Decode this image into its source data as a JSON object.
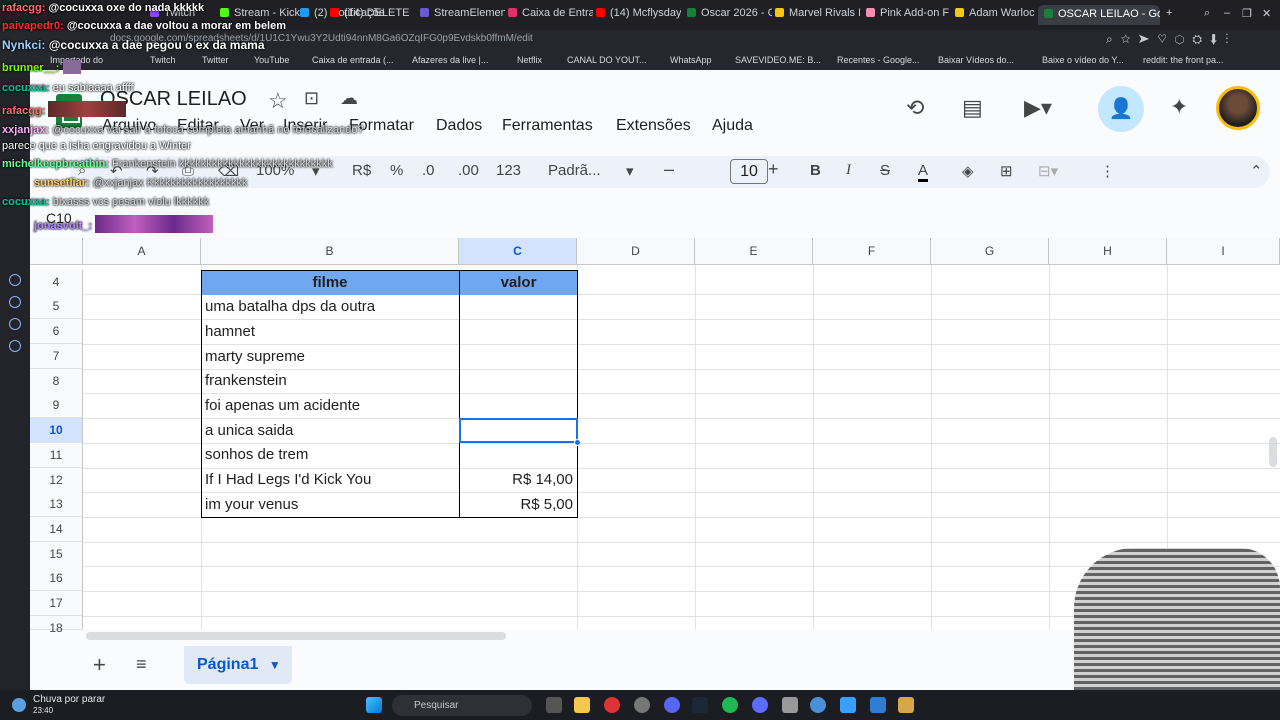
{
  "browser": {
    "tabs": [
      {
        "label": "Twitch",
        "color": "#9146ff"
      },
      {
        "label": "Stream - Kick",
        "color": "#53fc18"
      },
      {
        "label": "(2) Notificaçõe",
        "color": "#1d9bf0"
      },
      {
        "label": "(14) DELETE O",
        "color": "#ff0000"
      },
      {
        "label": "StreamElemen",
        "color": "#6a5acd"
      },
      {
        "label": "Caixa de Entra",
        "color": "#e1306c"
      },
      {
        "label": "(14) Mcflysday",
        "color": "#ff0000"
      },
      {
        "label": "Oscar 2026 - G",
        "color": "#188038"
      },
      {
        "label": "Marvel Rivals M",
        "color": "#f5c518"
      },
      {
        "label": "Pink Add-on F",
        "color": "#f48fb1"
      },
      {
        "label": "Adam Warlock",
        "color": "#f5c518"
      },
      {
        "label": "OSCAR LEILAO - Google",
        "color": "#188038"
      }
    ],
    "url": "docs.google.com/spreadsheets/d/1U1C1Ywu3Y2Udti94nnM8Ga6OZqIFG0p9Evdskb0ffmM/edit",
    "bookmarks": [
      "Importado do",
      "Twitch",
      "Twitter",
      "YouTube",
      "Caixa de entrada (...",
      "Afazeres da live |...",
      "Netflix",
      "CANAL DO YOUT...",
      "WhatsApp",
      "SAVEVIDEO.ME: B...",
      "Recentes - Google...",
      "Baixar Vídeos do...",
      "Baixe o vídeo do Y...",
      "reddit: the front pa..."
    ]
  },
  "sheets": {
    "title": "OSCAR LEILAO",
    "menu": [
      "Arquivo",
      "Editar",
      "Ver",
      "Inserir",
      "Formatar",
      "Dados",
      "Ferramentas",
      "Extensões",
      "Ajuda"
    ],
    "toolbar": {
      "zoom": "100%",
      "currency": "R$",
      "percent": "%",
      "dec_less": ".0",
      "dec_more": ".00",
      "number_fmt": "123",
      "font": "Padrã...",
      "font_size": "10"
    },
    "name_box": "C10",
    "columns": [
      "A",
      "B",
      "C",
      "D",
      "E",
      "F",
      "G",
      "H",
      "I"
    ],
    "rows": [
      "4",
      "5",
      "6",
      "7",
      "8",
      "9",
      "10",
      "11",
      "12",
      "13",
      "14",
      "15",
      "16",
      "17",
      "18"
    ],
    "selected_row": "10",
    "selected_column": "C",
    "header_fill": "#6fa8f0",
    "table": {
      "header": {
        "filme": "filme",
        "valor": "valor"
      },
      "rows": [
        {
          "filme": "uma batalha dps da outra",
          "valor": ""
        },
        {
          "filme": "hamnet",
          "valor": ""
        },
        {
          "filme": "marty supreme",
          "valor": ""
        },
        {
          "filme": "frankenstein",
          "valor": ""
        },
        {
          "filme": "foi apenas um acidente",
          "valor": ""
        },
        {
          "filme": "a unica saida",
          "valor": ""
        },
        {
          "filme": "sonhos de trem",
          "valor": ""
        },
        {
          "filme": "If I Had Legs I'd Kick You",
          "valor": "R$ 14,00"
        },
        {
          "filme": "im your venus",
          "valor": "R$ 5,00"
        }
      ]
    },
    "sheet_tab": "Página1"
  },
  "chat": [
    {
      "user": "rafacgg:",
      "msg": "@cocuxxa oxe do nada kkkkk",
      "color": "#ff6b6b"
    },
    {
      "user": "paivapedr0:",
      "msg": "@cocuxxa a dae voltou a morar em belem",
      "color": "#ff2b2b"
    },
    {
      "user": "Nynkci:",
      "msg": "@cocuxxa a dae pegou o ex da mama",
      "color": "#9ad0ff"
    },
    {
      "user": "brunner__:",
      "msg": "",
      "color": "#7cfc00"
    },
    {
      "user": "cocuxxa:",
      "msg": "eu sabiaaaa affff",
      "color": "#00c8a0"
    },
    {
      "user": "rafacgg:",
      "msg": "",
      "color": "#ff6b6b"
    },
    {
      "user": "xxjanjax:",
      "msg": "@cocuxxa vai sair a fofoca completa amanhã no fofocalizando?",
      "color": "#ffb0ff"
    },
    {
      "user": "",
      "msg": "parece que a isha engravidou a Winter",
      "color": "#ffffff"
    },
    {
      "user": "michelkeepbreathin:",
      "msg": "Frankenstein kkkkkkkkkkkkkkkkkkkkkkkkkkkk",
      "color": "#66ff99"
    },
    {
      "user": "sunsetliar:",
      "msg": "@xxjanjax Kkkkkkkkkkkkkkkkkk",
      "color": "#ffcc66"
    },
    {
      "user": "cocuxxa:",
      "msg": "bixasss vcs pesam violu lkkkkkk",
      "color": "#00c8a0"
    },
    {
      "user": "jonasvolt_:",
      "msg": "",
      "color": "#b388ff"
    }
  ],
  "taskbar": {
    "weather": "Chuva por parar",
    "time": "23:40",
    "search_placeholder": "Pesquisar"
  }
}
